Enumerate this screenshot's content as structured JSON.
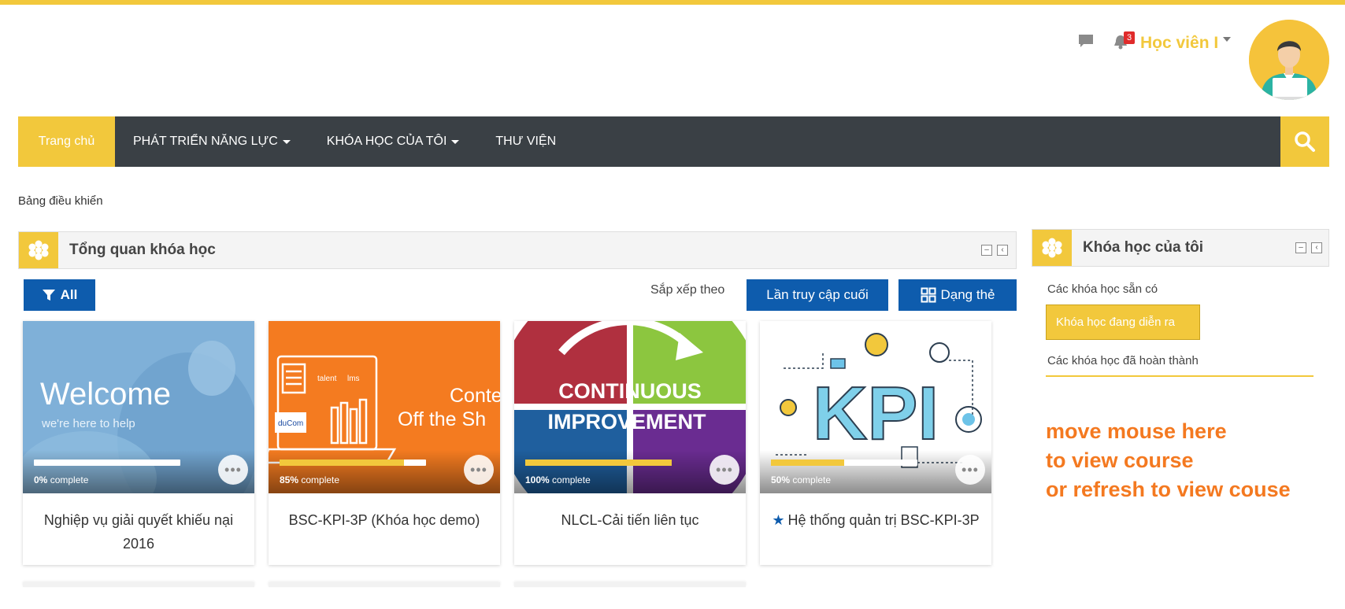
{
  "header": {
    "notification_count": "3",
    "user_name": "Học viên I"
  },
  "nav": {
    "home": "Trang chủ",
    "develop": "PHÁT TRIỂN NĂNG LỰC",
    "my_courses": "KHÓA HỌC CỦA TÔI",
    "library": "THƯ VIỆN"
  },
  "breadcrumb": "Bảng điều khiển",
  "overview": {
    "title": "Tổng quan khóa học",
    "filter_label": "All",
    "sort_label": "Sắp xếp theo",
    "sort_button": "Lần truy cập cuối",
    "view_button": "Dạng thẻ"
  },
  "courses": [
    {
      "title": "Nghiệp vụ giải quyết khiếu nại 2016",
      "percent": "0%",
      "progress": 0,
      "complete_label": "complete",
      "image_text_1": "Welcome",
      "image_text_2": "we're here to help",
      "starred": false
    },
    {
      "title": "BSC-KPI-3P (Khóa học demo)",
      "percent": "85%",
      "progress": 85,
      "complete_label": "complete",
      "image_text_1": "Conte",
      "image_text_2": "Off the Sh",
      "image_brand_1": "talent",
      "image_brand_2": "lms",
      "image_brand_3": "duCom",
      "starred": false
    },
    {
      "title": "NLCL-Cải tiến liên tục",
      "percent": "100%",
      "progress": 100,
      "complete_label": "complete",
      "image_text_1": "CONTINUOUS",
      "image_text_2": "IMPROVEMENT",
      "starred": false
    },
    {
      "title": "Hệ thống quản trị BSC-KPI-3P",
      "percent": "50%",
      "progress": 50,
      "complete_label": "complete",
      "image_text_1": "KPI",
      "starred": true
    }
  ],
  "my_courses_block": {
    "title": "Khóa học của tôi",
    "items": [
      "Các khóa học sẵn có",
      "Khóa học đang diễn ra",
      "Các khóa học đã hoàn thành"
    ]
  },
  "hint": {
    "line1": "move mouse here",
    "line2": "to view course",
    "line3": "or refresh to view couse"
  },
  "colors": {
    "accent": "#f2c83c",
    "nav_bg": "#3a4045",
    "button_blue": "#0e5cad",
    "hint_orange": "#f47920"
  }
}
